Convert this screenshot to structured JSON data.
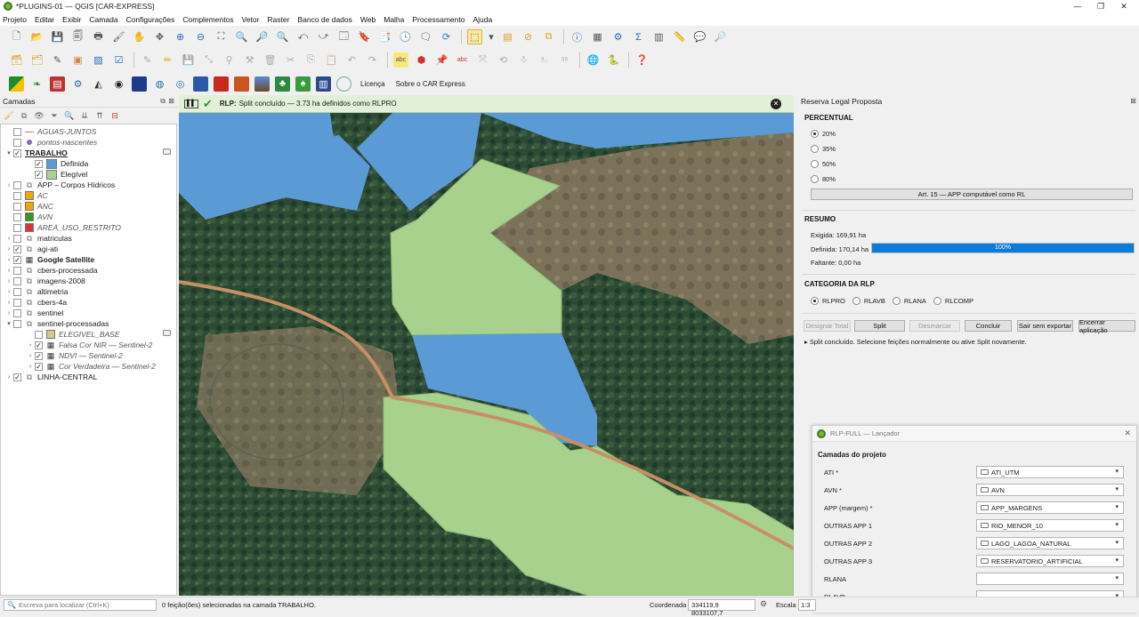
{
  "window": {
    "title": "*PLUGINS-01 — QGIS [CAR-EXPRESS]"
  },
  "menu": [
    "Projeto",
    "Editar",
    "Exibir",
    "Camada",
    "Configurações",
    "Complementos",
    "Vetor",
    "Raster",
    "Banco de dados",
    "Web",
    "Malha",
    "Processamento",
    "Ajuda"
  ],
  "plugin_toolbar": {
    "license_label": "Licença",
    "about_label": "Sobre o CAR Express"
  },
  "layers_panel": {
    "title": "Camadas",
    "items": [
      {
        "label": "AGUAS-JUNTOS",
        "italic": true,
        "checked": false
      },
      {
        "label": "pontos-nascentes",
        "italic": true,
        "checked": false
      },
      {
        "label": "TRABALHO",
        "bold": true,
        "underline": true,
        "checked": true
      },
      {
        "label": "Definida",
        "checked": true
      },
      {
        "label": "Elegível",
        "checked": true
      },
      {
        "label": "APP – Corpos Hídricos",
        "checked": false
      },
      {
        "label": "AC",
        "italic": true,
        "checked": false
      },
      {
        "label": "ANC",
        "italic": true,
        "checked": false
      },
      {
        "label": "AVN",
        "italic": true,
        "checked": false
      },
      {
        "label": "AREA_USO_RESTRITO",
        "italic": true,
        "checked": false
      },
      {
        "label": "matriculas",
        "checked": false
      },
      {
        "label": "agi-ati",
        "checked": true
      },
      {
        "label": "Google Satellite",
        "bold": true,
        "checked": true
      },
      {
        "label": "cbers-processada",
        "checked": false
      },
      {
        "label": "imagens-2008",
        "checked": false
      },
      {
        "label": "altimetria",
        "checked": false
      },
      {
        "label": "cbers-4a",
        "checked": false
      },
      {
        "label": "sentinel",
        "checked": false
      },
      {
        "label": "sentinel-processadas",
        "checked": false
      },
      {
        "label": "ELEGIVEL_BASE",
        "italic": true,
        "checked": false
      },
      {
        "label": "Falsa Cor NIR — Sentinel-2",
        "italic": true,
        "checked": true
      },
      {
        "label": "NDVI — Sentinel-2",
        "italic": true,
        "checked": true
      },
      {
        "label": "Cor Verdadeira — Sentinel-2",
        "italic": true,
        "checked": true
      },
      {
        "label": "LINHA-CENTRAL",
        "checked": true
      }
    ],
    "colors": {
      "definida": "#5b9bd5",
      "elegivel": "#a9d18e",
      "ac": "#f0a500",
      "anc": "#f0a500",
      "avn": "#2e9a1e",
      "area_uso_restrito": "#e03030"
    }
  },
  "message_bar": {
    "prefix": "RLP:",
    "text": "Split concluído — 3.73 ha definidos como RLPRO"
  },
  "rlp_panel": {
    "title": "Reserva Legal Proposta",
    "percentual": {
      "heading": "PERCENTUAL",
      "options": [
        "20%",
        "35%",
        "50%",
        "80%"
      ],
      "selected": "20%",
      "art_button": "Art. 15 — APP computável como RL"
    },
    "resumo": {
      "heading": "RESUMO",
      "exigida": "Exigida: 169,91 ha",
      "definida": "Definida: 170,14 ha",
      "progress_label": "100%",
      "progress": 1.0,
      "faltante": "Faltante: 0,00 ha"
    },
    "categoria": {
      "heading": "CATEGORIA DA RLP",
      "options": [
        "RLPRO",
        "RLAVB",
        "RLANA",
        "RLCOMP"
      ],
      "selected": "RLPRO"
    },
    "buttons": {
      "designar": "Designar Total",
      "split": "Split",
      "desmarcar": "Desmarcar",
      "concluir": "Concluir",
      "sair": "Sair sem exportar",
      "encerrar": "Encerrar aplicação"
    },
    "status": "▸ Split concluído. Selecione feições normalmente ou ative Split novamente."
  },
  "launcher": {
    "title": "RLP-FULL — Lançador",
    "heading": "Camadas do projeto",
    "rows": [
      {
        "label": "ATI *",
        "value": "ATI_UTM"
      },
      {
        "label": "AVN *",
        "value": "AVN"
      },
      {
        "label": "APP (margem) *",
        "value": "APP_MARGENS"
      },
      {
        "label": "OUTRAS APP 1",
        "value": "RIO_MENOR_10"
      },
      {
        "label": "OUTRAS APP 2",
        "value": "LAGO_LAGOA_NATURAL"
      },
      {
        "label": "OUTRAS APP 3",
        "value": "RESERVATORIO_ARTIFICIAL"
      },
      {
        "label": "RLANA",
        "value": ""
      },
      {
        "label": "RLAVB",
        "value": ""
      }
    ]
  },
  "status_bar": {
    "search_placeholder": "Escreva para localizar (Ctrl+K)",
    "message": "0 feição(ões) selecionadas na camada TRABALHO.",
    "coord_label": "Coordenada",
    "coord_value": "334119,9  8033107,7",
    "scale_label": "Escala",
    "scale_value": "1:3"
  }
}
